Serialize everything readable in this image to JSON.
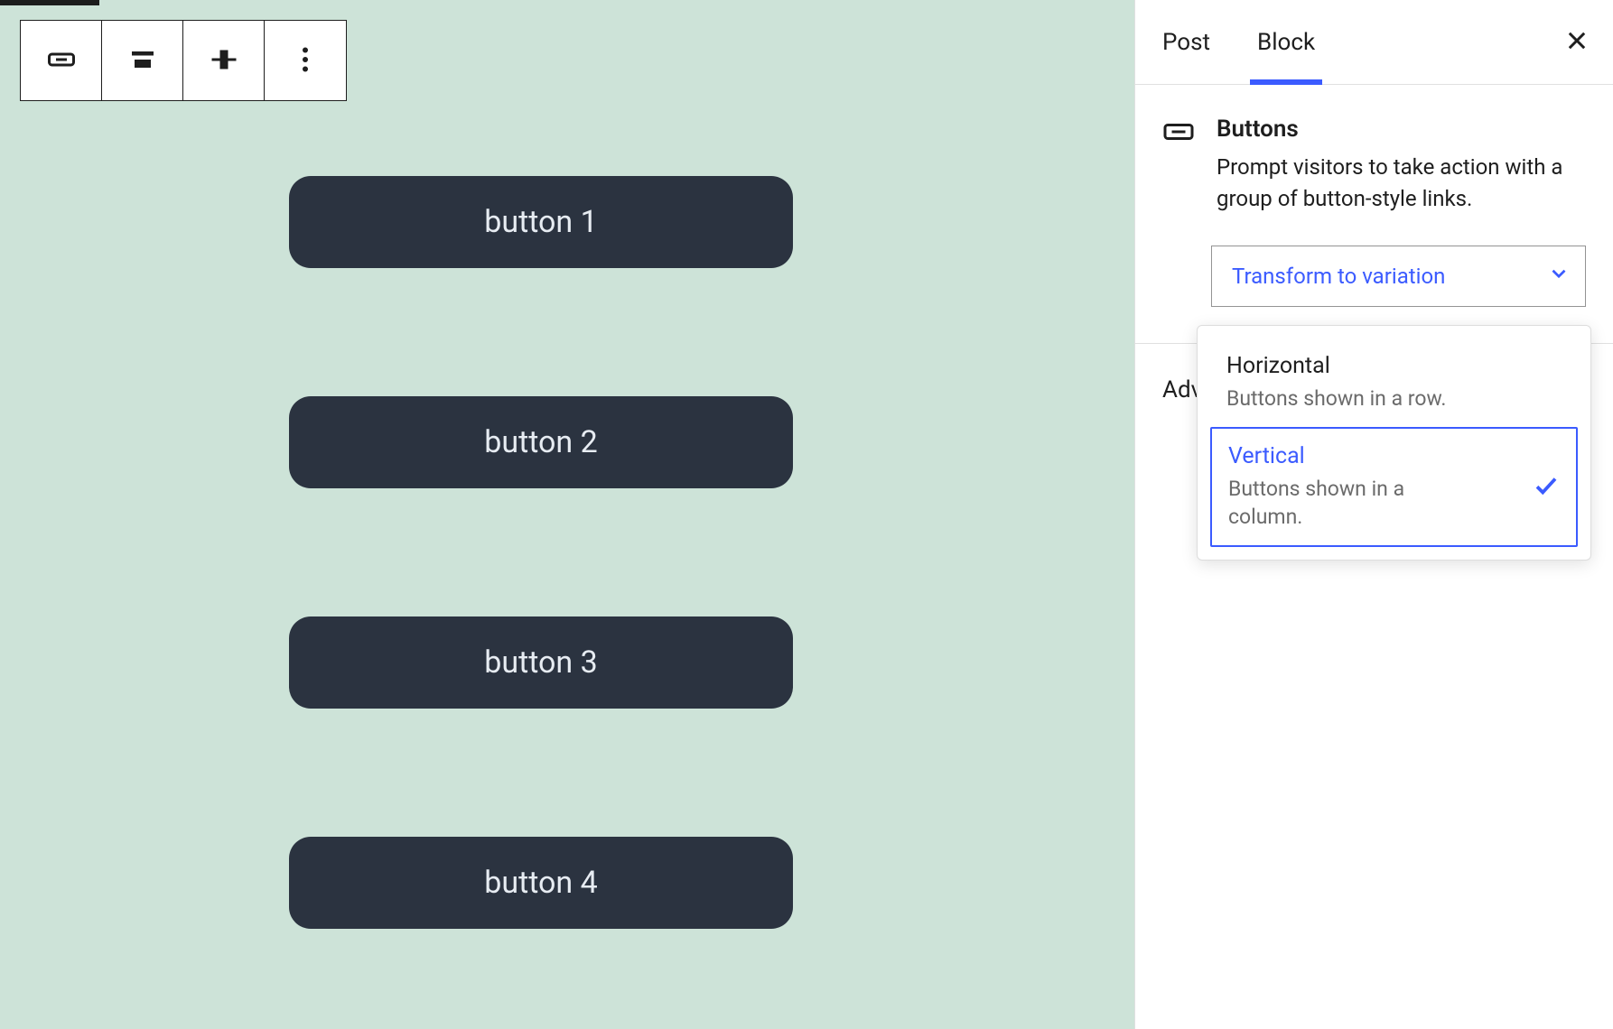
{
  "canvas": {
    "buttons": [
      "button 1",
      "button 2",
      "button 3",
      "button 4"
    ]
  },
  "toolbar": {
    "icons": [
      "buttons-block-icon",
      "align-icon",
      "justify-icon",
      "more-icon"
    ]
  },
  "sidebar": {
    "tabs": {
      "post": "Post",
      "block": "Block"
    },
    "block": {
      "title": "Buttons",
      "description": "Prompt visitors to take action with a group of button-style links."
    },
    "transform": {
      "label": "Transform to variation",
      "options": [
        {
          "label": "Horizontal",
          "description": "Buttons shown in a row.",
          "selected": false
        },
        {
          "label": "Vertical",
          "description": "Buttons shown in a column.",
          "selected": true
        }
      ]
    },
    "advanced_label": "Advanced",
    "advanced_visible_text": "Adva"
  },
  "colors": {
    "accent": "#3b5bff",
    "canvas_bg": "#cde3d8",
    "button_bg": "#2b3340"
  }
}
